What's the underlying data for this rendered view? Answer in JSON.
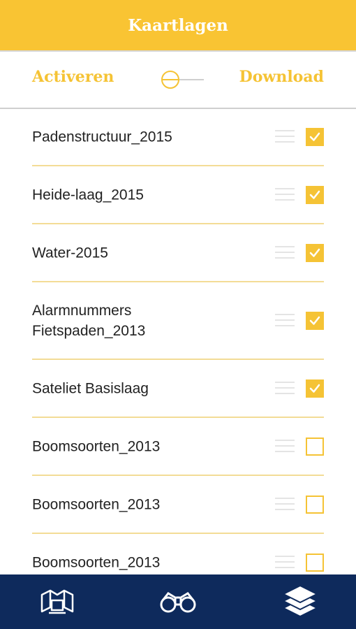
{
  "header": {
    "title": "Kaartlagen"
  },
  "mode": {
    "left_label": "Activeren",
    "right_label": "Download"
  },
  "layers": [
    {
      "label": "Padenstructuur_2015",
      "checked": true
    },
    {
      "label": "Heide-laag_2015",
      "checked": true
    },
    {
      "label": "Water-2015",
      "checked": true
    },
    {
      "label": "Alarmnummers\nFietspaden_2013",
      "checked": true
    },
    {
      "label": "Sateliet Basislaag",
      "checked": true
    },
    {
      "label": "Boomsoorten_2013",
      "checked": false
    },
    {
      "label": "Boomsoorten_2013",
      "checked": false
    },
    {
      "label": "Boomsoorten_2013",
      "checked": false
    }
  ],
  "tabs": [
    {
      "icon": "map-icon"
    },
    {
      "icon": "binoculars-icon"
    },
    {
      "icon": "layers-icon",
      "active": true
    }
  ],
  "colors": {
    "accent": "#f9c433",
    "navy": "#0e2a5c"
  }
}
